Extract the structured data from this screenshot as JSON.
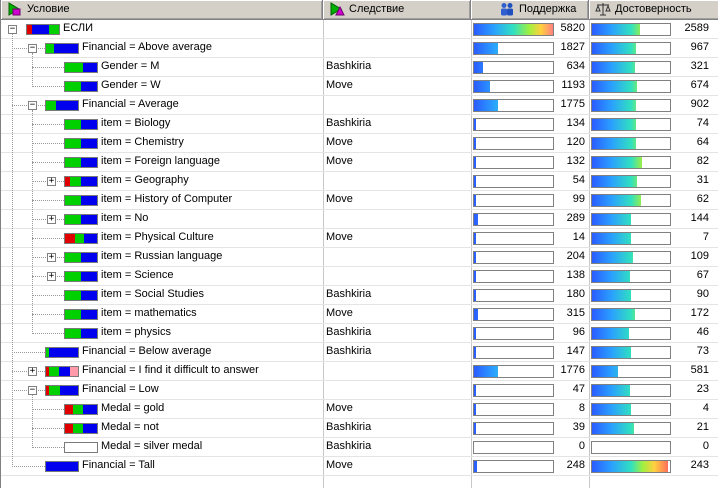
{
  "header": {
    "condition": "Условие",
    "consequence": "Следствие",
    "support": "Поддержка",
    "confidence": "Достоверность"
  },
  "colors": {
    "green": "#00d000",
    "blue": "#0000ee",
    "red": "#e00000",
    "pink": "#ff9aaa"
  },
  "rows": [
    {
      "label": "ЕСЛИ",
      "consequence": "",
      "support": "5820",
      "confidence": "2589",
      "s": 1.0,
      "c": 0.62,
      "level": 0,
      "toggle": "minus",
      "icon": [
        [
          "red",
          0.15
        ],
        [
          "blue",
          0.55
        ],
        [
          "green",
          0.3
        ]
      ]
    },
    {
      "label": "Financial = Above average",
      "consequence": "",
      "support": "1827",
      "confidence": "967",
      "s": 0.31,
      "c": 0.56,
      "level": 1,
      "toggle": "minus",
      "icon": [
        [
          "green",
          0.25
        ],
        [
          "blue",
          0.75
        ]
      ]
    },
    {
      "label": "Gender = M",
      "consequence": "Bashkiria",
      "support": "634",
      "confidence": "321",
      "s": 0.11,
      "c": 0.55,
      "level": 2,
      "toggle": "",
      "icon": [
        [
          "green",
          0.55
        ],
        [
          "blue",
          0.45
        ]
      ]
    },
    {
      "label": "Gender = W",
      "consequence": "Move",
      "support": "1193",
      "confidence": "674",
      "s": 0.2,
      "c": 0.58,
      "level": 2,
      "toggle": "",
      "icon": [
        [
          "green",
          0.5
        ],
        [
          "blue",
          0.5
        ]
      ]
    },
    {
      "label": "Financial = Average",
      "consequence": "",
      "support": "1775",
      "confidence": "902",
      "s": 0.3,
      "c": 0.56,
      "level": 1,
      "toggle": "minus",
      "icon": [
        [
          "green",
          0.3
        ],
        [
          "blue",
          0.7
        ]
      ]
    },
    {
      "label": "item = Biology",
      "consequence": "Bashkiria",
      "support": "134",
      "confidence": "74",
      "s": 0.02,
      "c": 0.57,
      "level": 2,
      "toggle": "",
      "icon": [
        [
          "green",
          0.5
        ],
        [
          "blue",
          0.5
        ]
      ]
    },
    {
      "label": "item = Chemistry",
      "consequence": "Move",
      "support": "120",
      "confidence": "64",
      "s": 0.02,
      "c": 0.56,
      "level": 2,
      "toggle": "",
      "icon": [
        [
          "green",
          0.5
        ],
        [
          "blue",
          0.5
        ]
      ]
    },
    {
      "label": "item = Foreign language",
      "consequence": "Move",
      "support": "132",
      "confidence": "82",
      "s": 0.02,
      "c": 0.64,
      "level": 2,
      "toggle": "",
      "icon": [
        [
          "green",
          0.5
        ],
        [
          "blue",
          0.5
        ]
      ]
    },
    {
      "label": "item = Geography",
      "consequence": "",
      "support": "54",
      "confidence": "31",
      "s": 0.01,
      "c": 0.58,
      "level": 2,
      "toggle": "plus",
      "icon": [
        [
          "red",
          0.15
        ],
        [
          "green",
          0.35
        ],
        [
          "blue",
          0.5
        ]
      ]
    },
    {
      "label": "item = History of Computer",
      "consequence": "Move",
      "support": "99",
      "confidence": "62",
      "s": 0.02,
      "c": 0.63,
      "level": 2,
      "toggle": "",
      "icon": [
        [
          "green",
          0.5
        ],
        [
          "blue",
          0.5
        ]
      ]
    },
    {
      "label": "item = No",
      "consequence": "",
      "support": "289",
      "confidence": "144",
      "s": 0.05,
      "c": 0.5,
      "level": 2,
      "toggle": "plus",
      "icon": [
        [
          "green",
          0.5
        ],
        [
          "blue",
          0.5
        ]
      ]
    },
    {
      "label": "item = Physical Culture",
      "consequence": "Move",
      "support": "14",
      "confidence": "7",
      "s": 0.005,
      "c": 0.5,
      "level": 2,
      "toggle": "",
      "icon": [
        [
          "red",
          0.3
        ],
        [
          "green",
          0.3
        ],
        [
          "blue",
          0.4
        ]
      ]
    },
    {
      "label": "item = Russian language",
      "consequence": "",
      "support": "204",
      "confidence": "109",
      "s": 0.03,
      "c": 0.53,
      "level": 2,
      "toggle": "plus",
      "icon": [
        [
          "green",
          0.5
        ],
        [
          "blue",
          0.5
        ]
      ]
    },
    {
      "label": "item = Science",
      "consequence": "",
      "support": "138",
      "confidence": "67",
      "s": 0.02,
      "c": 0.49,
      "level": 2,
      "toggle": "plus",
      "icon": [
        [
          "green",
          0.5
        ],
        [
          "blue",
          0.5
        ]
      ]
    },
    {
      "label": "item = Social Studies",
      "consequence": "Bashkiria",
      "support": "180",
      "confidence": "90",
      "s": 0.03,
      "c": 0.5,
      "level": 2,
      "toggle": "",
      "icon": [
        [
          "green",
          0.5
        ],
        [
          "blue",
          0.5
        ]
      ]
    },
    {
      "label": "item = mathematics",
      "consequence": "Move",
      "support": "315",
      "confidence": "172",
      "s": 0.05,
      "c": 0.55,
      "level": 2,
      "toggle": "",
      "icon": [
        [
          "green",
          0.5
        ],
        [
          "blue",
          0.5
        ]
      ]
    },
    {
      "label": "item = physics",
      "consequence": "Bashkiria",
      "support": "96",
      "confidence": "46",
      "s": 0.02,
      "c": 0.48,
      "level": 2,
      "toggle": "",
      "icon": [
        [
          "green",
          0.5
        ],
        [
          "blue",
          0.5
        ]
      ]
    },
    {
      "label": "Financial = Below average",
      "consequence": "Bashkiria",
      "support": "147",
      "confidence": "73",
      "s": 0.02,
      "c": 0.5,
      "level": 1,
      "toggle": "",
      "icon": [
        [
          "green",
          0.1
        ],
        [
          "blue",
          0.9
        ]
      ]
    },
    {
      "label": "Financial = I find it difficult to answer",
      "consequence": "",
      "support": "1776",
      "confidence": "581",
      "s": 0.31,
      "c": 0.33,
      "level": 1,
      "toggle": "plus",
      "icon": [
        [
          "red",
          0.1
        ],
        [
          "green",
          0.3
        ],
        [
          "blue",
          0.35
        ],
        [
          "pink",
          0.25
        ]
      ]
    },
    {
      "label": "Financial = Low",
      "consequence": "",
      "support": "47",
      "confidence": "23",
      "s": 0.01,
      "c": 0.49,
      "level": 1,
      "toggle": "minus",
      "icon": [
        [
          "red",
          0.1
        ],
        [
          "green",
          0.35
        ],
        [
          "blue",
          0.55
        ]
      ]
    },
    {
      "label": "Medal = gold",
      "consequence": "Move",
      "support": "8",
      "confidence": "4",
      "s": 0.003,
      "c": 0.5,
      "level": 2,
      "toggle": "",
      "icon": [
        [
          "red",
          0.25
        ],
        [
          "green",
          0.3
        ],
        [
          "blue",
          0.45
        ]
      ]
    },
    {
      "label": "Medal = not",
      "consequence": "Bashkiria",
      "support": "39",
      "confidence": "21",
      "s": 0.01,
      "c": 0.54,
      "level": 2,
      "toggle": "",
      "icon": [
        [
          "red",
          0.25
        ],
        [
          "green",
          0.3
        ],
        [
          "blue",
          0.45
        ]
      ]
    },
    {
      "label": "Medal = silver medal",
      "consequence": "Bashkiria",
      "support": "0",
      "confidence": "0",
      "s": 0.0,
      "c": 0.0,
      "level": 2,
      "toggle": "",
      "icon": []
    },
    {
      "label": "Financial = Tall",
      "consequence": "Move",
      "support": "248",
      "confidence": "243",
      "s": 0.04,
      "c": 0.98,
      "level": 1,
      "toggle": "",
      "icon": [
        [
          "blue",
          1.0
        ]
      ]
    }
  ]
}
